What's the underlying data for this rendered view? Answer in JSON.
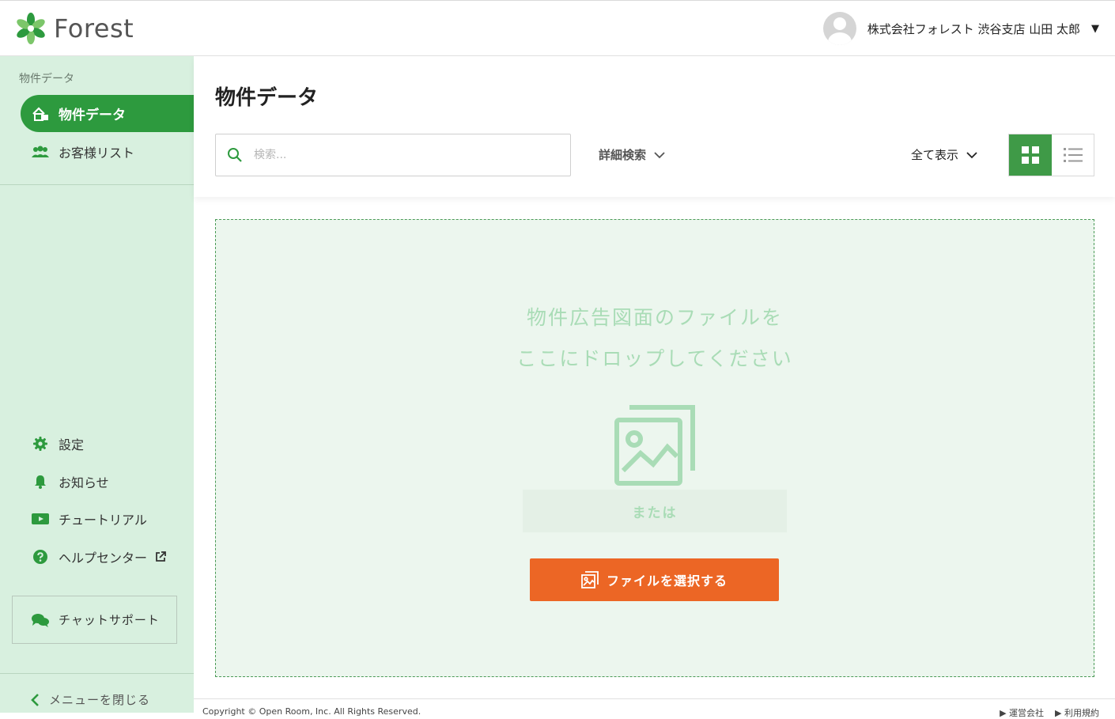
{
  "header": {
    "logo_text": "Forest",
    "user_name": "株式会社フォレスト 渋谷支店 山田 太郎",
    "caret": "▼"
  },
  "sidebar": {
    "section_title": "物件データ",
    "active_item": "物件データ",
    "items": [
      {
        "label": "お客様リスト"
      }
    ],
    "bottom_items": [
      {
        "label": "設定"
      },
      {
        "label": "お知らせ"
      },
      {
        "label": "チュートリアル"
      },
      {
        "label": "ヘルプセンター"
      }
    ],
    "chat_support": "チャットサポート",
    "close_menu": "メニューを閉じる"
  },
  "main": {
    "title": "物件データ",
    "search_placeholder": "検索...",
    "advanced_search": "詳細検索",
    "show_all": "全て表示",
    "dropzone": {
      "line1": "物件広告図面のファイルを",
      "line2": "ここにドロップしてください",
      "or": "または",
      "select_button": "ファイルを選択する"
    }
  },
  "footer": {
    "copyright": "Copyright © Open Room, Inc. All Rights Reserved.",
    "links": [
      "▶ 運営会社",
      "▶ 利用規約"
    ]
  },
  "colors": {
    "brand_green": "#2d9a3e",
    "sidebar_bg": "#d8f0df",
    "cta_orange": "#ec6625"
  }
}
